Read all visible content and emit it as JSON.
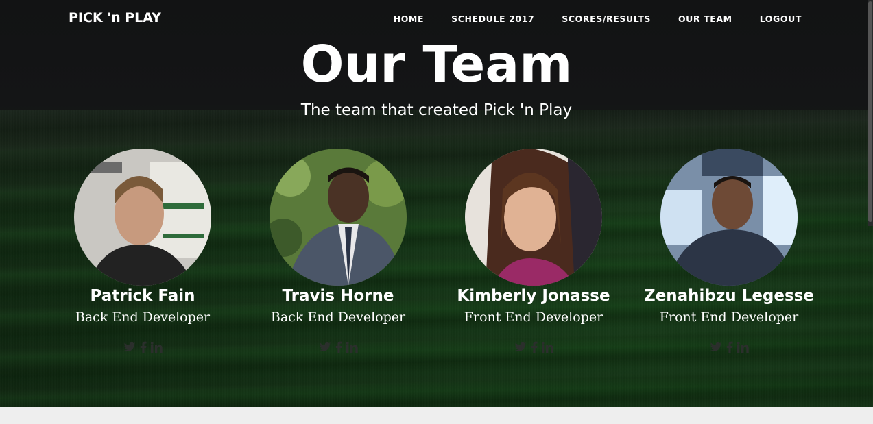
{
  "header": {
    "brand": "PICK 'n PLAY",
    "nav": [
      "HOME",
      "SCHEDULE 2017",
      "SCORES/RESULTS",
      "OUR TEAM",
      "LOGOUT"
    ]
  },
  "hero": {
    "title": "Our Team",
    "subtitle": "The team that created Pick 'n Play"
  },
  "team": [
    {
      "name": "Patrick Fain",
      "role": "Back End Developer"
    },
    {
      "name": "Travis Horne",
      "role": "Back End Developer"
    },
    {
      "name": "Kimberly Jonasse",
      "role": "Front End Developer"
    },
    {
      "name": "Zenahibzu Legesse",
      "role": "Front End Developer"
    }
  ],
  "social_icons": [
    "twitter-icon",
    "facebook-icon",
    "linkedin-icon"
  ],
  "colors": {
    "header_bg": "#121314",
    "text": "#ffffff",
    "social_icon": "#2b2f2c",
    "footer_bg": "#eeeeee"
  }
}
